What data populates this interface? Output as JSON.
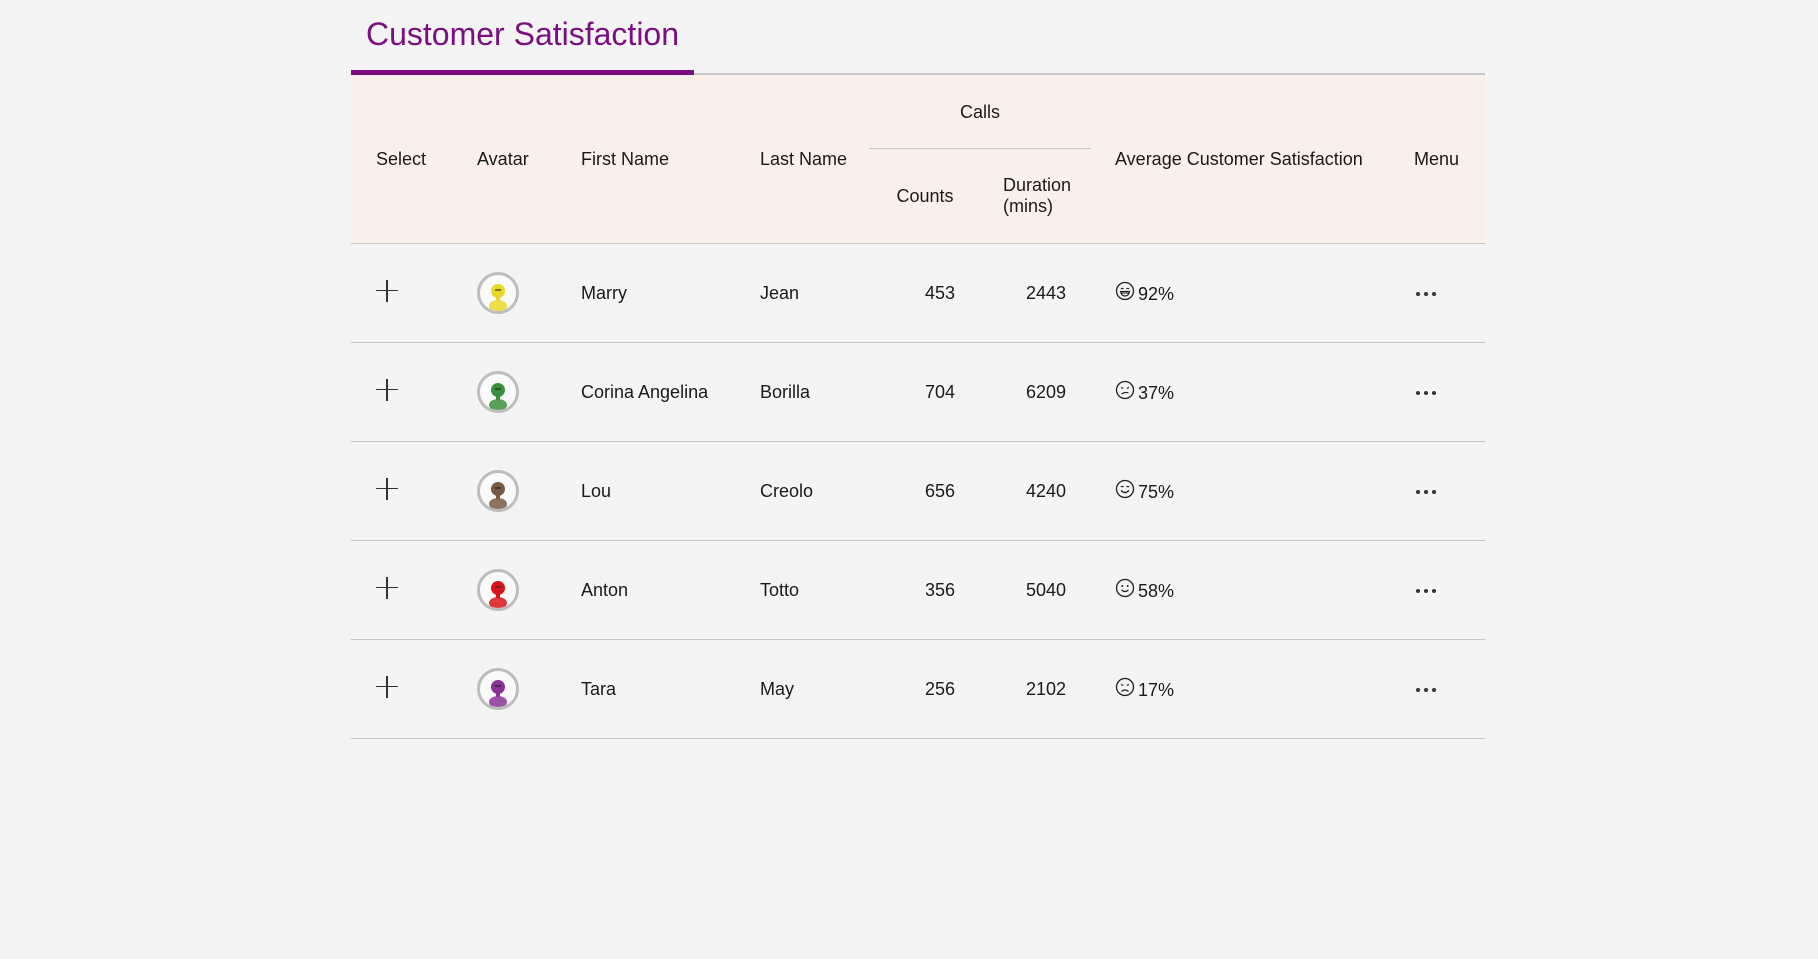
{
  "page": {
    "title": "Customer Satisfaction"
  },
  "table": {
    "headers": {
      "select": "Select",
      "avatar": "Avatar",
      "first_name": "First Name",
      "last_name": "Last Name",
      "calls": "Calls",
      "counts": "Counts",
      "duration": "Duration (mins)",
      "avg_satisfaction": "Average Customer Satisfaction",
      "menu": "Menu"
    },
    "rows": [
      {
        "first_name": "Marry",
        "last_name": "Jean",
        "counts": "453",
        "duration": "2443",
        "satisfaction": "92%",
        "face_icon": "grinning-face-icon",
        "avatar_color": "#e6d829"
      },
      {
        "first_name": "Corina Angelina",
        "last_name": "Borilla",
        "counts": "704",
        "duration": "6209",
        "satisfaction": "37%",
        "face_icon": "confused-face-icon",
        "avatar_color": "#3c8f3c"
      },
      {
        "first_name": "Lou",
        "last_name": "Creolo",
        "counts": "656",
        "duration": "4240",
        "satisfaction": "75%",
        "face_icon": "smiling-face-icon",
        "avatar_color": "#7a5a40"
      },
      {
        "first_name": "Anton",
        "last_name": "Totto",
        "counts": "356",
        "duration": "5040",
        "satisfaction": "58%",
        "face_icon": "slight-smile-face-icon",
        "avatar_color": "#d8141a"
      },
      {
        "first_name": "Tara",
        "last_name": "May",
        "counts": "256",
        "duration": "2102",
        "satisfaction": "17%",
        "face_icon": "frowning-face-icon",
        "avatar_color": "#8a3296"
      }
    ]
  },
  "colors": {
    "accent": "#7a0f82",
    "header_bg": "#f9f0eb",
    "page_bg": "#f4f4f4"
  }
}
